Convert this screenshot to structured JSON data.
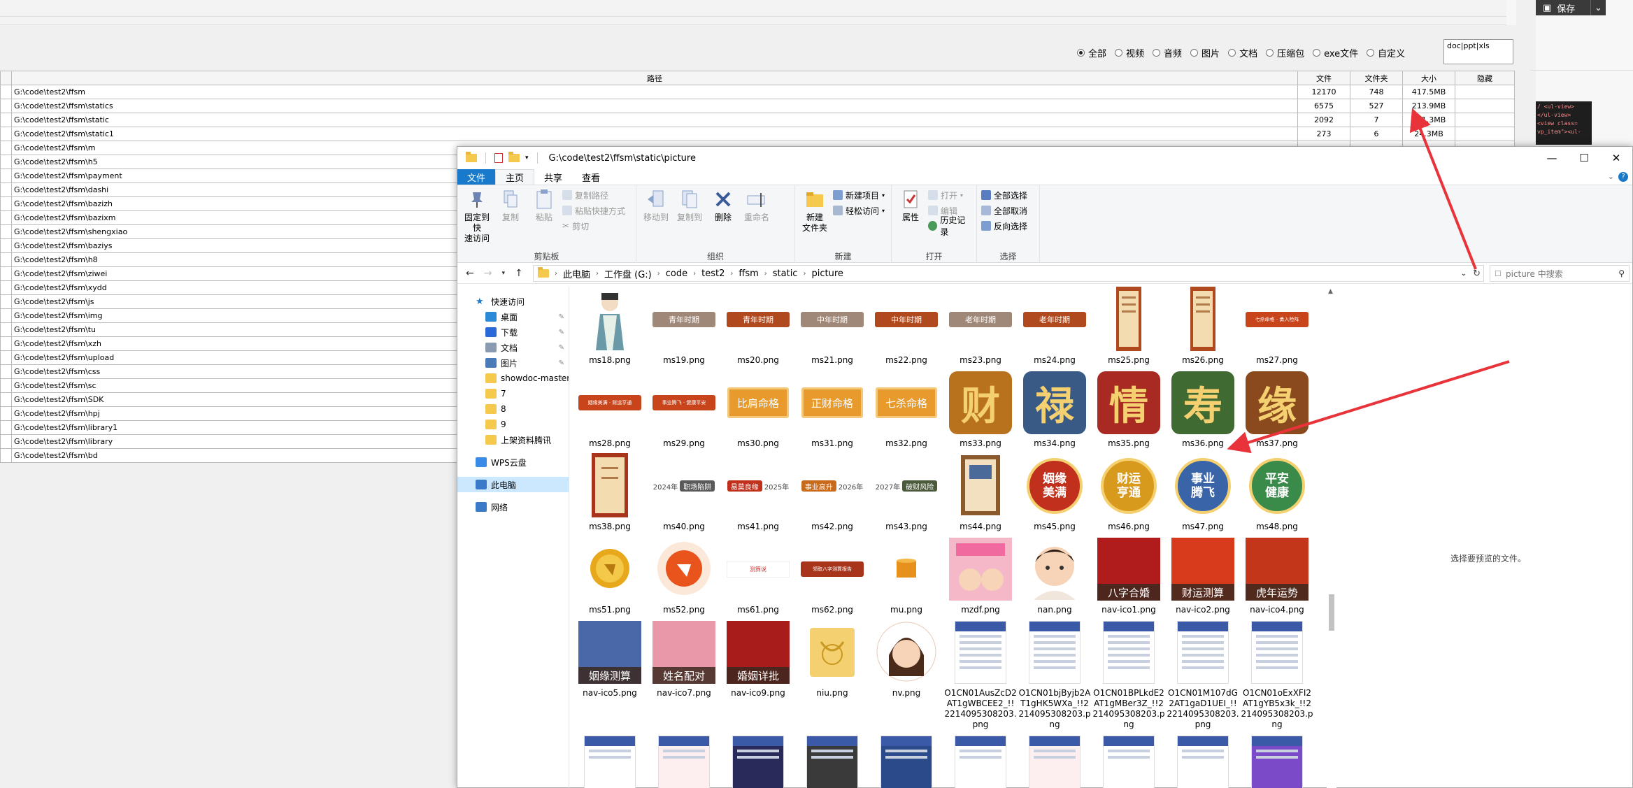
{
  "background_app": {
    "filters": [
      {
        "label": "全部",
        "selected": true
      },
      {
        "label": "视频",
        "selected": false
      },
      {
        "label": "音频",
        "selected": false
      },
      {
        "label": "图片",
        "selected": false
      },
      {
        "label": "文档",
        "selected": false
      },
      {
        "label": "压缩包",
        "selected": false
      },
      {
        "label": "exe文件",
        "selected": false
      },
      {
        "label": "自定义",
        "selected": false
      }
    ],
    "custom_ext_value": "doc|ppt|xls",
    "table": {
      "headers": [
        "路径",
        "文件",
        "文件夹",
        "大小",
        "隐藏"
      ],
      "rows": [
        [
          "G:\\code\\test2\\ffsm",
          "12170",
          "748",
          "417.5MB",
          ""
        ],
        [
          "G:\\code\\test2\\ffsm\\statics",
          "6575",
          "527",
          "213.9MB",
          ""
        ],
        [
          "G:\\code\\test2\\ffsm\\static",
          "2092",
          "7",
          "101.3MB",
          ""
        ],
        [
          "G:\\code\\test2\\ffsm\\static1",
          "273",
          "6",
          "24.3MB",
          ""
        ],
        [
          "G:\\code\\test2\\ffsm\\m",
          "",
          "",
          "",
          ""
        ],
        [
          "G:\\code\\test2\\ffsm\\h5",
          "",
          "",
          "",
          ""
        ],
        [
          "G:\\code\\test2\\ffsm\\payment",
          "",
          "",
          "",
          ""
        ],
        [
          "G:\\code\\test2\\ffsm\\dashi",
          "",
          "",
          "",
          ""
        ],
        [
          "G:\\code\\test2\\ffsm\\bazizh",
          "",
          "",
          "",
          ""
        ],
        [
          "G:\\code\\test2\\ffsm\\bazixm",
          "",
          "",
          "",
          ""
        ],
        [
          "G:\\code\\test2\\ffsm\\shengxiao",
          "",
          "",
          "",
          ""
        ],
        [
          "G:\\code\\test2\\ffsm\\baziys",
          "",
          "",
          "",
          ""
        ],
        [
          "G:\\code\\test2\\ffsm\\h8",
          "",
          "",
          "",
          ""
        ],
        [
          "G:\\code\\test2\\ffsm\\ziwei",
          "",
          "",
          "",
          ""
        ],
        [
          "G:\\code\\test2\\ffsm\\xydd",
          "",
          "",
          "",
          ""
        ],
        [
          "G:\\code\\test2\\ffsm\\js",
          "",
          "",
          "",
          ""
        ],
        [
          "G:\\code\\test2\\ffsm\\img",
          "",
          "",
          "",
          ""
        ],
        [
          "G:\\code\\test2\\ffsm\\tu",
          "",
          "",
          "",
          ""
        ],
        [
          "G:\\code\\test2\\ffsm\\xzh",
          "",
          "",
          "",
          ""
        ],
        [
          "G:\\code\\test2\\ffsm\\upload",
          "",
          "",
          "",
          ""
        ],
        [
          "G:\\code\\test2\\ffsm\\css",
          "",
          "",
          "",
          ""
        ],
        [
          "G:\\code\\test2\\ffsm\\sc",
          "",
          "",
          "",
          ""
        ],
        [
          "G:\\code\\test2\\ffsm\\SDK",
          "",
          "",
          "",
          ""
        ],
        [
          "G:\\code\\test2\\ffsm\\hpj",
          "",
          "",
          "",
          ""
        ],
        [
          "G:\\code\\test2\\ffsm\\library1",
          "",
          "",
          "",
          ""
        ],
        [
          "G:\\code\\test2\\ffsm\\library",
          "",
          "",
          "",
          ""
        ],
        [
          "G:\\code\\test2\\ffsm\\bd",
          "",
          "",
          "",
          ""
        ]
      ]
    },
    "save_label": "保存",
    "code_lines": [
      "/ <ul-view>",
      "</ul-view>",
      "<view class=",
      "vp_item\"><ul-"
    ]
  },
  "explorer": {
    "title_path": "G:\\code\\test2\\ffsm\\static\\picture",
    "tabs": [
      "文件",
      "主页",
      "共享",
      "查看"
    ],
    "active_tab": "主页",
    "ribbon": {
      "clipboard": {
        "label": "剪贴板",
        "pin": "固定到快\n速访问",
        "copy": "复制",
        "paste": "粘贴",
        "copy_path": "复制路径",
        "paste_shortcut": "粘贴快捷方式",
        "cut": "剪切"
      },
      "organize": {
        "label": "组织",
        "move_to": "移动到",
        "copy_to": "复制到",
        "delete": "删除",
        "rename": "重命名"
      },
      "new": {
        "label": "新建",
        "new_folder": "新建\n文件夹",
        "new_item": "新建项目",
        "easy_access": "轻松访问"
      },
      "open": {
        "label": "打开",
        "properties": "属性",
        "open": "打开",
        "edit": "编辑",
        "history": "历史记录"
      },
      "select": {
        "label": "选择",
        "select_all": "全部选择",
        "select_none": "全部取消",
        "invert": "反向选择"
      }
    },
    "breadcrumbs": [
      "此电脑",
      "工作盘 (G:)",
      "code",
      "test2",
      "ffsm",
      "static",
      "picture"
    ],
    "search_placeholder": "picture 中搜索",
    "nav": [
      {
        "label": "快速访问",
        "type": "star",
        "level": 0
      },
      {
        "label": "桌面",
        "type": "desktop",
        "level": 1,
        "pin": true
      },
      {
        "label": "下载",
        "type": "download",
        "level": 1,
        "pin": true
      },
      {
        "label": "文档",
        "type": "docs",
        "level": 1,
        "pin": true
      },
      {
        "label": "图片",
        "type": "pics",
        "level": 1,
        "pin": true
      },
      {
        "label": "showdoc-master",
        "type": "folder",
        "level": 1,
        "pin": true
      },
      {
        "label": "7",
        "type": "folder",
        "level": 1
      },
      {
        "label": "8",
        "type": "folder",
        "level": 1
      },
      {
        "label": "9",
        "type": "folder",
        "level": 1
      },
      {
        "label": "上架资料腾讯",
        "type": "folder",
        "level": 1
      },
      {
        "label": "WPS云盘",
        "type": "cloud",
        "level": 0
      },
      {
        "label": "此电脑",
        "type": "pc",
        "level": 0,
        "selected": true
      },
      {
        "label": "网络",
        "type": "network",
        "level": 0
      }
    ],
    "files": [
      {
        "name": "ms18.png",
        "kind": "person"
      },
      {
        "name": "ms19.png",
        "kind": "banner",
        "text": "青年时期",
        "color": "#a08878"
      },
      {
        "name": "ms20.png",
        "kind": "banner",
        "text": "青年时期",
        "color": "#b04a1e"
      },
      {
        "name": "ms21.png",
        "kind": "banner",
        "text": "中年时期",
        "color": "#a08878"
      },
      {
        "name": "ms22.png",
        "kind": "banner",
        "text": "中年时期",
        "color": "#b04a1e"
      },
      {
        "name": "ms23.png",
        "kind": "banner",
        "text": "老年时期",
        "color": "#a08878"
      },
      {
        "name": "ms24.png",
        "kind": "banner",
        "text": "老年时期",
        "color": "#b04a1e"
      },
      {
        "name": "ms25.png",
        "kind": "scroll"
      },
      {
        "name": "ms26.png",
        "kind": "scroll"
      },
      {
        "name": "ms27.png",
        "kind": "banner",
        "text": "七杀命格 · 勇入险阵",
        "color": "#c8451c"
      },
      {
        "name": "ms28.png",
        "kind": "banner",
        "text": "姻缘美满 · 财运亨通",
        "color": "#c8451c"
      },
      {
        "name": "ms29.png",
        "kind": "banner",
        "text": "事业腾飞 · 健康平安",
        "color": "#c8451c"
      },
      {
        "name": "ms30.png",
        "kind": "plaque",
        "text": "比肩命格"
      },
      {
        "name": "ms31.png",
        "kind": "plaque",
        "text": "正财命格"
      },
      {
        "name": "ms32.png",
        "kind": "plaque",
        "text": "七杀命格"
      },
      {
        "name": "ms33.png",
        "kind": "char",
        "text": "财",
        "color": "#b8721e"
      },
      {
        "name": "ms34.png",
        "kind": "char",
        "text": "禄",
        "color": "#3a5a86"
      },
      {
        "name": "ms35.png",
        "kind": "char",
        "text": "情",
        "color": "#a82a22"
      },
      {
        "name": "ms36.png",
        "kind": "char",
        "text": "寿",
        "color": "#3f6a32"
      },
      {
        "name": "ms37.png",
        "kind": "char",
        "text": "缘",
        "color": "#8a4a1e"
      },
      {
        "name": "ms38.png",
        "kind": "scroll2"
      },
      {
        "name": "ms40.png",
        "kind": "yearban",
        "year": "2024年",
        "text": "职场陷阱",
        "color": "#5a5a5a"
      },
      {
        "name": "ms41.png",
        "kind": "yearban",
        "year": "2025年",
        "text": "易莫良缘",
        "color": "#c0301c"
      },
      {
        "name": "ms42.png",
        "kind": "yearban",
        "year": "2026年",
        "text": "事业高升",
        "color": "#c86a1c"
      },
      {
        "name": "ms43.png",
        "kind": "yearban",
        "year": "2027年",
        "text": "破财风险",
        "color": "#4a5a3a"
      },
      {
        "name": "ms44.png",
        "kind": "book"
      },
      {
        "name": "ms45.png",
        "kind": "circle",
        "text": "姻缘\n美满",
        "color": "#c0301c"
      },
      {
        "name": "ms46.png",
        "kind": "circle",
        "text": "财运\n亨通",
        "color": "#d89a1c"
      },
      {
        "name": "ms47.png",
        "kind": "circle",
        "text": "事业\n腾飞",
        "color": "#3a64a8"
      },
      {
        "name": "ms48.png",
        "kind": "circle",
        "text": "平安\n健康",
        "color": "#3a8a4a"
      },
      {
        "name": "ms51.png",
        "kind": "coin"
      },
      {
        "name": "ms52.png",
        "kind": "coin2"
      },
      {
        "name": "ms61.png",
        "kind": "smallcard",
        "text": "测算说"
      },
      {
        "name": "ms62.png",
        "kind": "banner",
        "text": "领取八字测算报告",
        "color": "#a8341c"
      },
      {
        "name": "mu.png",
        "kind": "cup"
      },
      {
        "name": "mzdf.png",
        "kind": "poster",
        "text": "",
        "color": "#f4b8c8"
      },
      {
        "name": "nan.png",
        "kind": "face"
      },
      {
        "name": "nav-ico1.png",
        "kind": "poster",
        "text": "八字合婚",
        "color": "#b01c1c"
      },
      {
        "name": "nav-ico2.png",
        "kind": "poster",
        "text": "财运测算",
        "color": "#d83a1c"
      },
      {
        "name": "nav-ico4.png",
        "kind": "poster",
        "text": "虎年运势",
        "color": "#c4361a"
      },
      {
        "name": "nav-ico5.png",
        "kind": "poster",
        "text": "姻缘测算",
        "color": "#4a68a8"
      },
      {
        "name": "nav-ico7.png",
        "kind": "poster",
        "text": "姓名配对",
        "color": "#e898a8"
      },
      {
        "name": "nav-ico9.png",
        "kind": "poster",
        "text": "婚姻详批",
        "color": "#a81c1c"
      },
      {
        "name": "niu.png",
        "kind": "ox"
      },
      {
        "name": "nv.png",
        "kind": "face2"
      },
      {
        "name": "O1CN01AusZcD2AT1gWBCEE2_!!2214095308203.png",
        "kind": "doc"
      },
      {
        "name": "O1CN01bjByjb2AT1gHK5WXa_!!2214095308203.png",
        "kind": "doc"
      },
      {
        "name": "O1CN01BPLkdE2AT1gMBer3Z_!!2214095308203.png",
        "kind": "doc"
      },
      {
        "name": "O1CN01M107dG2AT1gaD1UEI_!!2214095308203.png",
        "kind": "doc"
      },
      {
        "name": "O1CN01oExXFI2AT1gYB5x3k_!!2214095308203.png",
        "kind": "doc"
      }
    ],
    "preview_text": "选择要预览的文件。"
  }
}
